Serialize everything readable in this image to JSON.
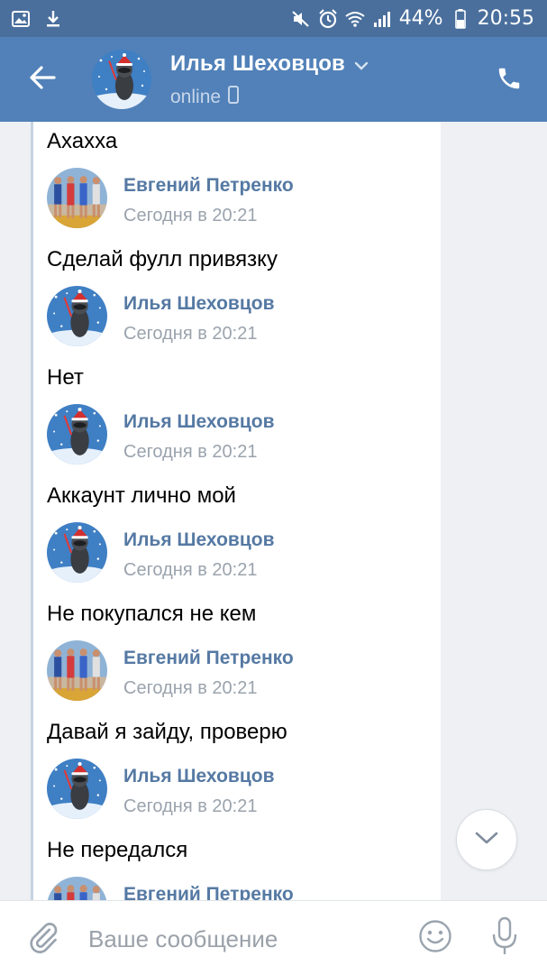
{
  "status_bar": {
    "battery": "44%",
    "time": "20:55",
    "icons": [
      "gallery-icon",
      "download-icon",
      "mute-icon",
      "alarm-icon",
      "wifi-icon",
      "signal-icon",
      "battery-icon"
    ]
  },
  "header": {
    "name": "Илья Шеховцов",
    "status": "online",
    "icons": [
      "back-arrow-icon",
      "chevron-down-icon",
      "phone-device-icon",
      "phone-call-icon"
    ]
  },
  "messages": [
    {
      "type": "text",
      "text": "Ахахха"
    },
    {
      "type": "author",
      "name": "Евгений Петренко",
      "time": "Сегодня в 20:21",
      "avatar": "group-photo"
    },
    {
      "type": "text",
      "text": "Сделай фулл привязку"
    },
    {
      "type": "author",
      "name": "Илья Шеховцов",
      "time": "Сегодня в 20:21",
      "avatar": "raccoon"
    },
    {
      "type": "text",
      "text": "Нет"
    },
    {
      "type": "author",
      "name": "Илья Шеховцов",
      "time": "Сегодня в 20:21",
      "avatar": "raccoon"
    },
    {
      "type": "text",
      "text": "Аккаунт лично мой"
    },
    {
      "type": "author",
      "name": "Илья Шеховцов",
      "time": "Сегодня в 20:21",
      "avatar": "raccoon"
    },
    {
      "type": "text",
      "text": "Не покупался не кем"
    },
    {
      "type": "author",
      "name": "Евгений Петренко",
      "time": "Сегодня в 20:21",
      "avatar": "group-photo"
    },
    {
      "type": "text",
      "text": "Давай я зайду, проверю"
    },
    {
      "type": "author",
      "name": "Илья Шеховцов",
      "time": "Сегодня в 20:21",
      "avatar": "raccoon"
    },
    {
      "type": "text",
      "text": "Не передался"
    },
    {
      "type": "author",
      "name": "Евгений Петренко",
      "time": "",
      "avatar": "group-photo"
    }
  ],
  "composer": {
    "placeholder": "Ваше сообщение",
    "icons": [
      "paperclip-icon",
      "emoji-icon",
      "microphone-icon"
    ]
  },
  "colors": {
    "status_bar": "#4a6f9d",
    "header": "#5181b8",
    "author_name": "#5579a3",
    "time": "#9aa3ad",
    "background": "#eef0f3"
  }
}
